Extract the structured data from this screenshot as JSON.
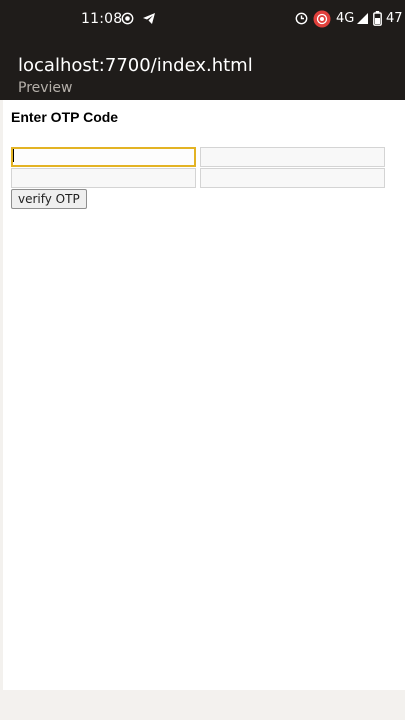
{
  "status_bar": {
    "time": "11:08",
    "network": "4G",
    "battery": "47"
  },
  "browser": {
    "url": "localhost:7700/index.html",
    "subtitle": "Preview"
  },
  "page": {
    "heading": "Enter OTP Code",
    "otp_fields": [
      {
        "value": "",
        "placeholder": ""
      },
      {
        "value": "",
        "placeholder": ""
      },
      {
        "value": "",
        "placeholder": ""
      },
      {
        "value": "",
        "placeholder": ""
      }
    ],
    "verify_button_label": "verify OTP"
  }
}
